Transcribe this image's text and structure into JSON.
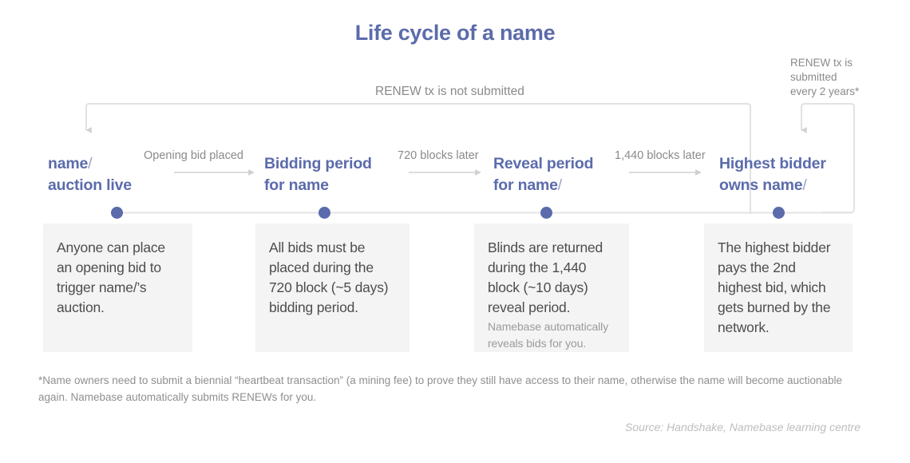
{
  "title": "Life cycle of a name",
  "colors": {
    "accent": "#5b6bab",
    "slash": "#9aa4ca",
    "line": "#dcdcdc",
    "card_bg": "#f4f4f4",
    "body_text": "#4d4d4d",
    "muted_text": "#8a8a8a",
    "source_text": "#bdbdbd"
  },
  "loops": {
    "not_submitted_label": "RENEW tx is not submitted",
    "submitted_label": "RENEW tx is\nsubmitted\nevery 2 years*"
  },
  "stages": [
    {
      "name": "auction-live",
      "line1": "name",
      "slash1": "/",
      "line2": "auction live",
      "slash2": "",
      "card_text": "Anyone can place an opening bid to trigger name/’s auction.",
      "card_sub": ""
    },
    {
      "name": "bidding-period",
      "line1": "Bidding period",
      "slash1": "",
      "line2": "for name",
      "slash2": "",
      "card_text": "All bids must be placed during the 720 block (~5 days) bidding period.",
      "card_sub": ""
    },
    {
      "name": "reveal-period",
      "line1": "Reveal period",
      "slash1": "",
      "line2": "for name",
      "slash2": "/",
      "card_text": "Blinds are returned during the 1,440 block (~10 days) reveal period.",
      "card_sub": "Namebase automatically reveals bids for you."
    },
    {
      "name": "highest-bidder",
      "line1": "Highest bidder",
      "slash1": "",
      "line2": "owns name",
      "slash2": "/",
      "card_text": "The highest bidder pays the 2nd highest bid, which gets burned by the network.",
      "card_sub": ""
    }
  ],
  "transitions": [
    {
      "name": "opening-bid",
      "label": "Opening bid placed"
    },
    {
      "name": "720-blocks",
      "label": "720 blocks later"
    },
    {
      "name": "1440-blocks",
      "label": "1,440 blocks later"
    }
  ],
  "footnote": "*Name owners need to submit a biennial “heartbeat transaction” (a mining fee) to prove they still have access to their name, otherwise the name will become auctionable again. Namebase automatically submits RENEWs for you.",
  "source": "Source: Handshake, Namebase learning centre"
}
